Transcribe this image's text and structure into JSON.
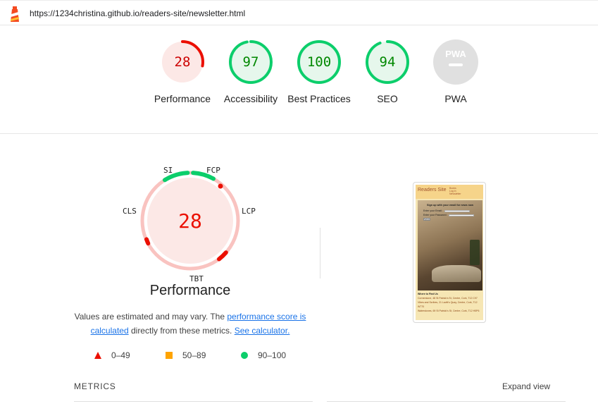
{
  "topbar": {
    "url": "https://1234christina.github.io/readers-site/newsletter.html",
    "icon": "lighthouse-icon"
  },
  "categories": [
    {
      "key": "performance",
      "score": "28",
      "value": 28,
      "label": "Performance",
      "status": "fail"
    },
    {
      "key": "accessibility",
      "score": "97",
      "value": 97,
      "label": "Accessibility",
      "status": "pass"
    },
    {
      "key": "best-practices",
      "score": "100",
      "value": 100,
      "label": "Best Practices",
      "status": "pass"
    },
    {
      "key": "seo",
      "score": "94",
      "value": 94,
      "label": "SEO",
      "status": "pass"
    },
    {
      "key": "pwa",
      "score": "PWA",
      "label": "PWA",
      "status": "na"
    }
  ],
  "performance": {
    "score": "28",
    "title": "Performance",
    "metric_labels": {
      "si": "SI",
      "fcp": "FCP",
      "lcp": "LCP",
      "tbt": "TBT",
      "cls": "CLS"
    },
    "description": {
      "prefix": "Values are estimated and may vary. The ",
      "link1": "performance score is calculated",
      "middle": " directly from these metrics. ",
      "link2": "See calculator."
    },
    "legend": [
      {
        "range": "0–49",
        "shape": "triangle",
        "color": "#eb0f00"
      },
      {
        "range": "50–89",
        "shape": "square",
        "color": "#ffa400"
      },
      {
        "range": "90–100",
        "shape": "circle",
        "color": "#0cce6b"
      }
    ]
  },
  "thumbnail": {
    "site_title": "Readers Site",
    "nav": [
      "Books",
      "Log in",
      "Newsletter"
    ],
    "form_heading": "Sign up with your email for news now",
    "email_label": "Enter your Email:",
    "password_label": "Enter your Password:",
    "submit_label": "Submit",
    "footer_heading": "Where to Find Us",
    "footer_lines": [
      "Cornerstone, 48 St Patrick's St, Centre, Cork, T12 C97",
      "Vibes and Scribes, 21 Lavitt's Quay, Centre, Cork, T12 W770",
      "Waterstones, 69 St Patrick's St, Centre, Cork, T12 H5P6"
    ]
  },
  "metrics": {
    "heading": "METRICS",
    "expand_label": "Expand view"
  },
  "colors": {
    "fail": "#eb0f00",
    "fail_bg": "#fce8e6",
    "pass": "#0cce6b",
    "pass_text": "#008800",
    "pass_bg": "#e6f7ec",
    "na_bg": "#e0e0e0",
    "link": "#1a73e8"
  }
}
